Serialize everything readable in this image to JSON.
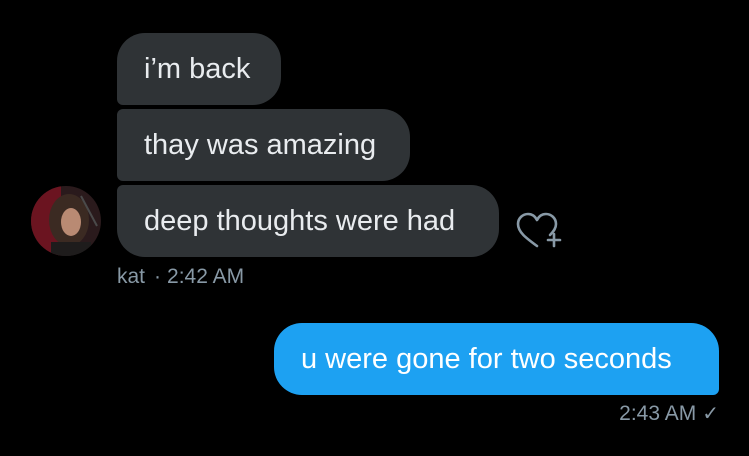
{
  "thread": {
    "incoming": {
      "messages": [
        "i’m back",
        "thay was amazing",
        "deep thoughts were had"
      ],
      "sender": "kat",
      "separator": "·",
      "time": "2:42 AM"
    },
    "outgoing": {
      "messages": [
        "u were gone for two seconds"
      ],
      "time": "2:43 AM",
      "status_icon": "checkmark-icon"
    },
    "reaction_icon": "heart-plus-icon"
  },
  "colors": {
    "background": "#000000",
    "incoming_bubble": "#2f3336",
    "outgoing_bubble": "#1da1f2",
    "meta_text": "#8899a6"
  }
}
